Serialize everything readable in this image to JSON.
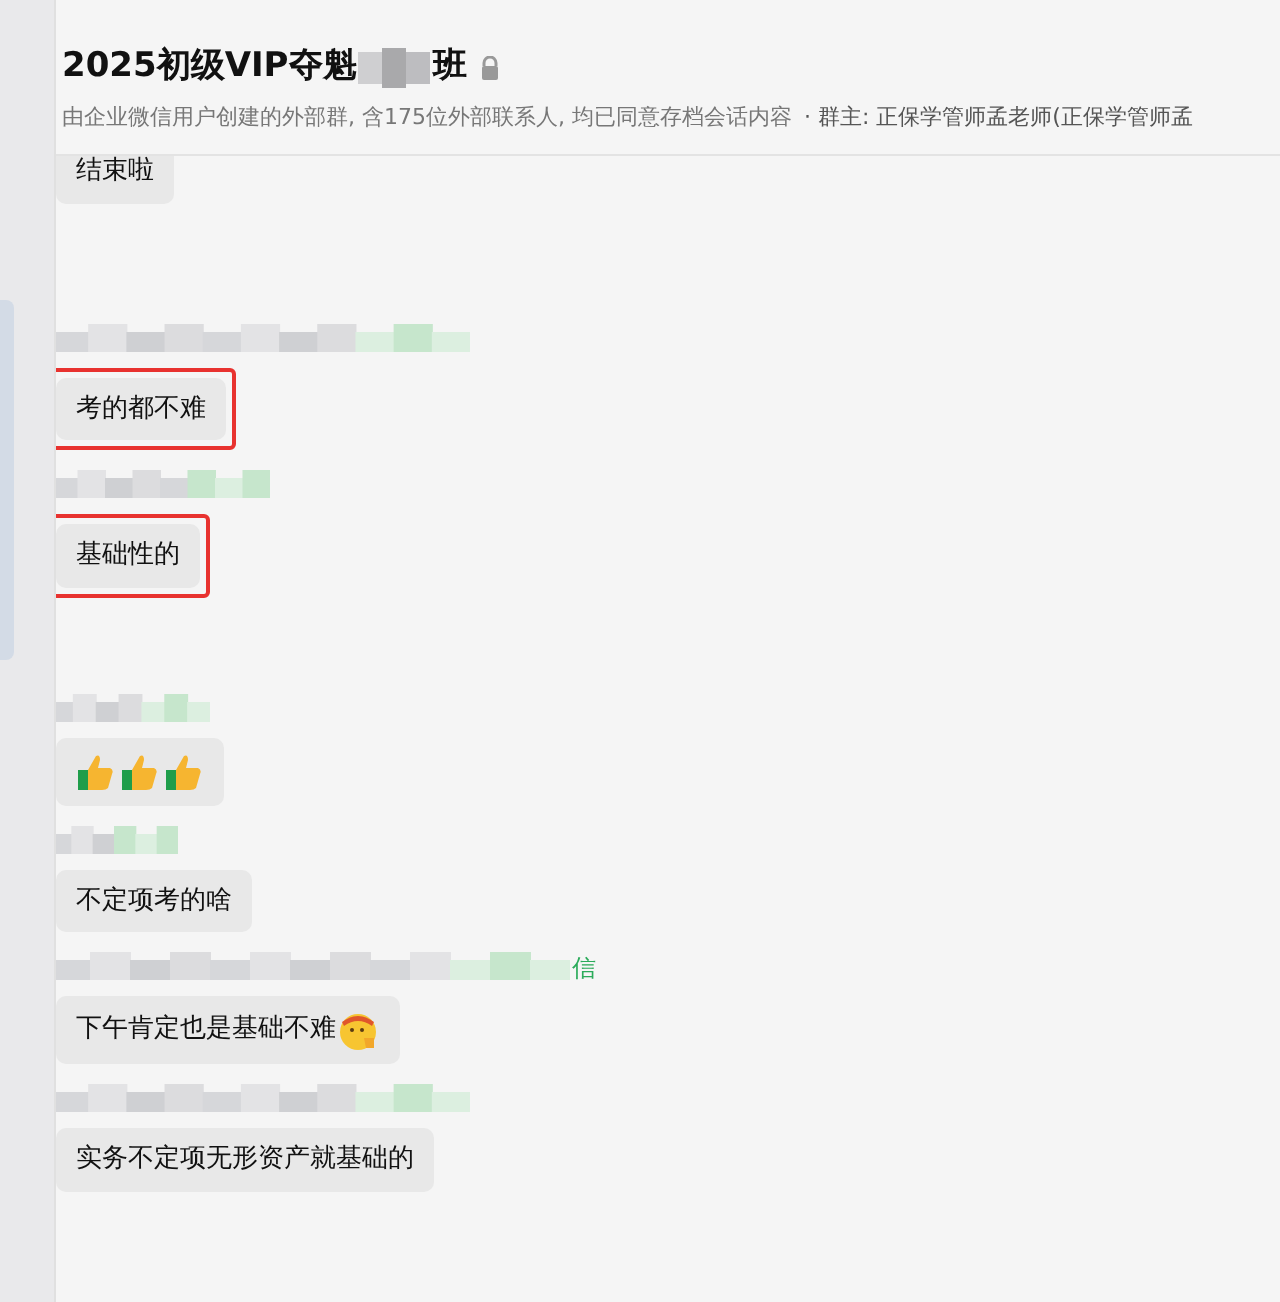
{
  "header": {
    "title_start": "2025初级VIP夺魁",
    "title_end": "班",
    "locked": true,
    "subtitle": "由企业微信用户创建的外部群, 含175位外部联系人, 均已同意存档会话内容",
    "owner": "· 群主: 正保学管师孟老师(正保学管师孟"
  },
  "messages": [
    {
      "kind": "text",
      "text": "结束啦",
      "highlighted": false
    },
    {
      "kind": "text",
      "text": "考的都不难",
      "highlighted": true,
      "sender": {
        "kind": "blurred"
      }
    },
    {
      "kind": "text",
      "text": "基础性的",
      "highlighted": true,
      "sender": {
        "kind": "blurred"
      }
    },
    {
      "kind": "emoji",
      "emojis": [
        {
          "kind": "thumbs_up"
        },
        {
          "kind": "thumbs_up"
        },
        {
          "kind": "thumbs_up"
        }
      ],
      "highlighted": false,
      "sender": {
        "kind": "blurred"
      }
    },
    {
      "kind": "text",
      "text": "不定项考的啥",
      "highlighted": false,
      "sender": {
        "kind": "blurred"
      }
    },
    {
      "kind": "text",
      "text": "下午肯定也是基础不难",
      "emojis": [
        {
          "kind": "salute"
        }
      ],
      "highlighted": false,
      "sender": {
        "kind": "blurred",
        "tail": "信"
      }
    },
    {
      "kind": "text",
      "text": "实务不定项无形资产就基础的",
      "highlighted": false,
      "sender": {
        "kind": "blurred"
      }
    }
  ]
}
